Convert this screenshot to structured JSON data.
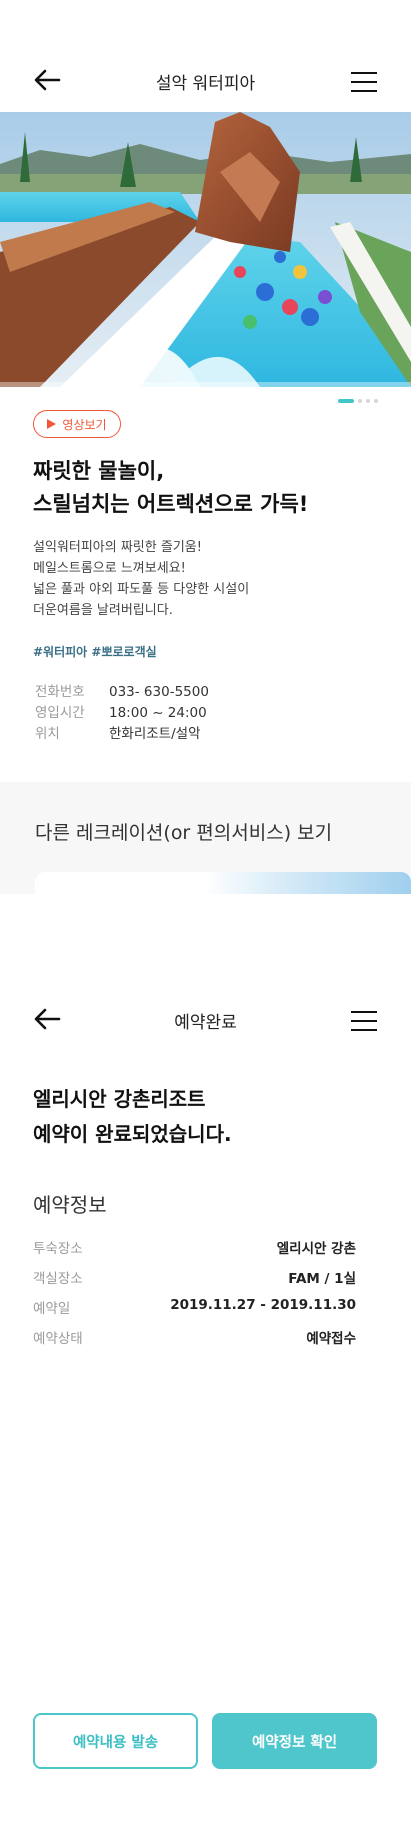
{
  "screen1": {
    "header": {
      "title": "설악 워터피아",
      "back_icon": "arrow-left-icon",
      "menu_icon": "hamburger-menu-icon"
    },
    "carousel": {
      "total": 4,
      "active": 0
    },
    "video_button": {
      "label": "영상보기"
    },
    "headline": {
      "line1": "짜릿한 물놀이,",
      "line2": "스릴넘치는 어트렉션으로 가득!"
    },
    "description": [
      "설익워터피아의 짜릿한 즐기움!",
      "메일스트롬으로 느껴보세요!",
      "넓은 풀과 야외 파도풀 등 다양한 시설이",
      "더운여름을 날려버립니다."
    ],
    "tags": "#워터피아 #뽀로로객실",
    "info": [
      {
        "key": "전화번호",
        "value": "033- 630-5500"
      },
      {
        "key": "영입시간",
        "value": "18:00 ~ 24:00"
      },
      {
        "key": "위치",
        "value": "한화리조트/설악"
      }
    ],
    "other_section": {
      "title": "다른 레크레이션(or 편의서비스) 보기"
    }
  },
  "screen2": {
    "header": {
      "title": "예약완료",
      "back_icon": "arrow-left-icon",
      "menu_icon": "hamburger-menu-icon"
    },
    "title": {
      "line1": "엘리시안 강촌리조트",
      "line2": "예약이 완료되었습니다."
    },
    "section_title": "예약정보",
    "info": [
      {
        "key": "투숙장소",
        "value": "엘리시안 강촌"
      },
      {
        "key": "객실장소",
        "value": "FAM / 1실"
      },
      {
        "key": "예약일",
        "value": "2019.11.27 - 2019.11.30"
      },
      {
        "key": "예약상태",
        "value": "예약접수"
      }
    ],
    "buttons": {
      "send": "예약내용 발송",
      "confirm": "예약정보 확인"
    }
  },
  "colors": {
    "accent": "#4ec6cc",
    "video_red": "#f0583a",
    "tag_blue": "#3a6f86"
  }
}
